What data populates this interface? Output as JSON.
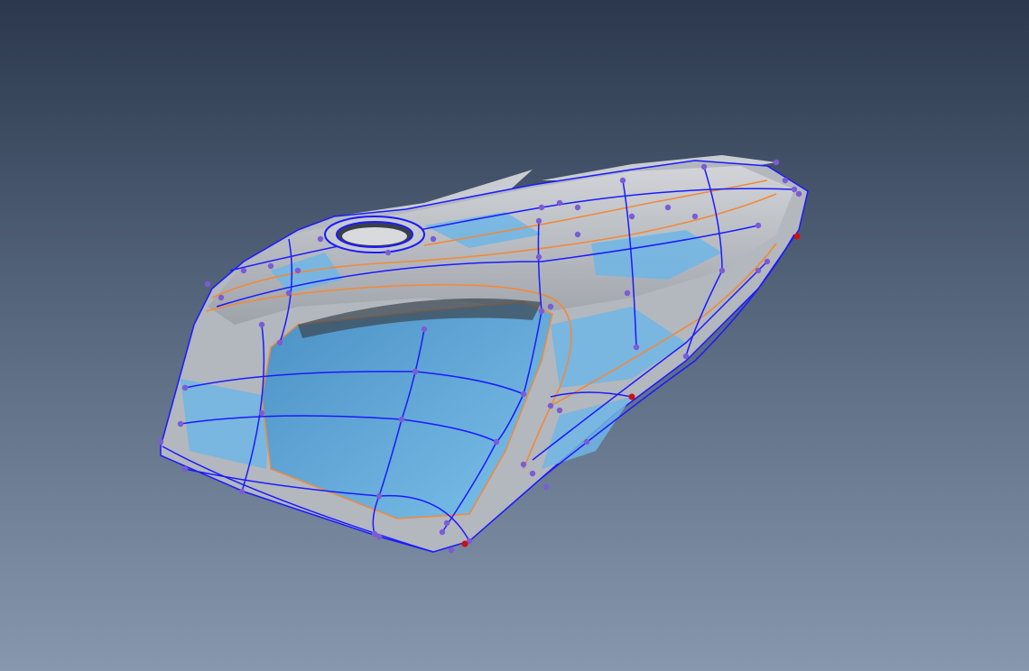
{
  "viewport": {
    "background_top": "#2b384d",
    "background_bottom": "#8797ad"
  },
  "model": {
    "surface_color": "#b9bcc2",
    "highlight_color": "#6fb6e6",
    "cavity_color": "#5ea6d6",
    "edge_color": "#1a1aff",
    "trim_curve_color": "#f08a3c",
    "control_point_color": "#7b5cd6",
    "selected_point_color": "#cc1010"
  }
}
